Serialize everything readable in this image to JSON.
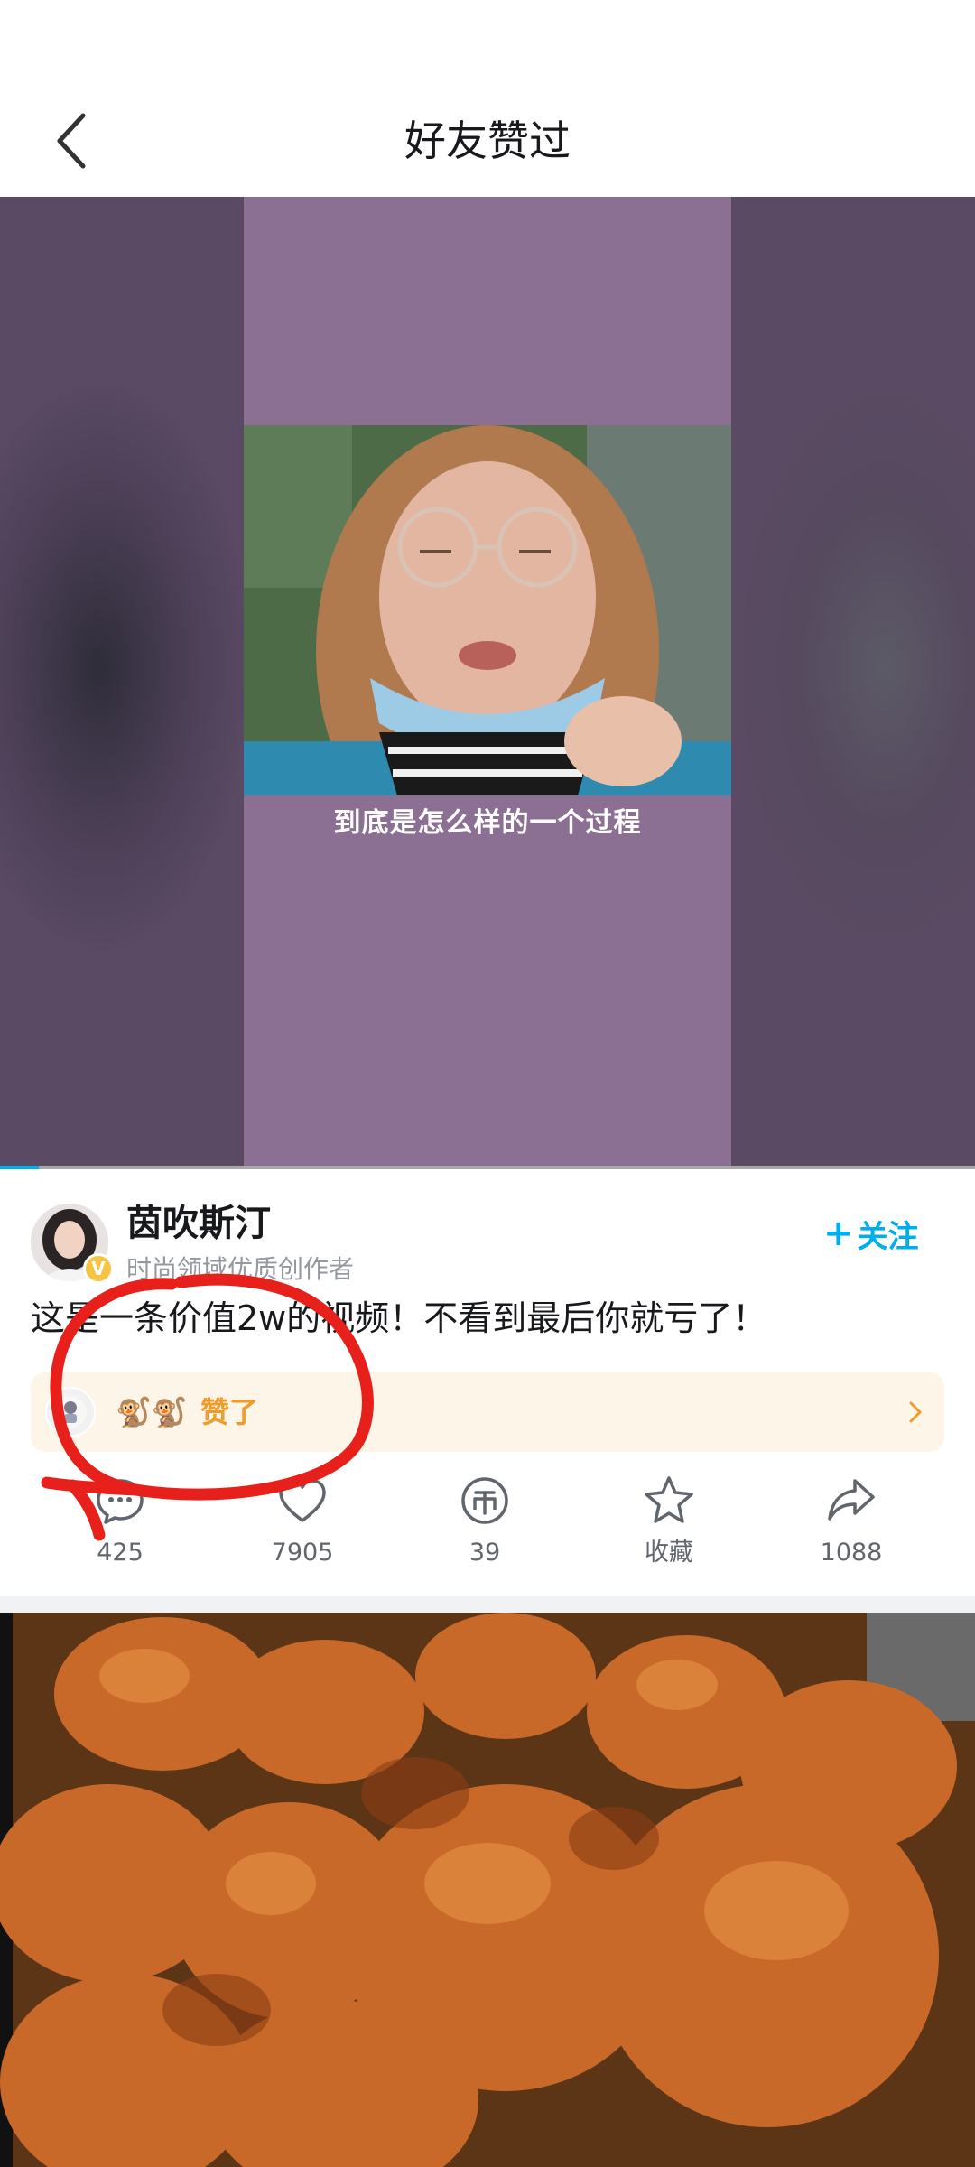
{
  "header": {
    "title": "好友赞过"
  },
  "video": {
    "subtitle": "到底是怎么样的一个过程",
    "progress_fraction": 0.04
  },
  "author": {
    "name": "茵吹斯汀",
    "description": "时尚领域优质创作者",
    "badge": "V",
    "follow_label": "关注"
  },
  "video_title": "这是一条价值2w的视频！不看到最后你就亏了！",
  "friend_like": {
    "friend_name": "🐒🐒",
    "text": "赞了"
  },
  "actions": {
    "comment_count": "425",
    "like_count": "7905",
    "coin_count": "39",
    "favorite_label": "收藏",
    "share_count": "1088"
  },
  "colors": {
    "accent_blue": "#00aeec",
    "banner_bg": "#fdf5e8",
    "banner_text": "#ef9b2d",
    "annotation_red": "#e8201c"
  },
  "icons": [
    "back-arrow-icon",
    "plus-icon",
    "comment-icon",
    "heart-icon",
    "coin-icon",
    "star-icon",
    "share-icon",
    "chevron-right-icon"
  ]
}
